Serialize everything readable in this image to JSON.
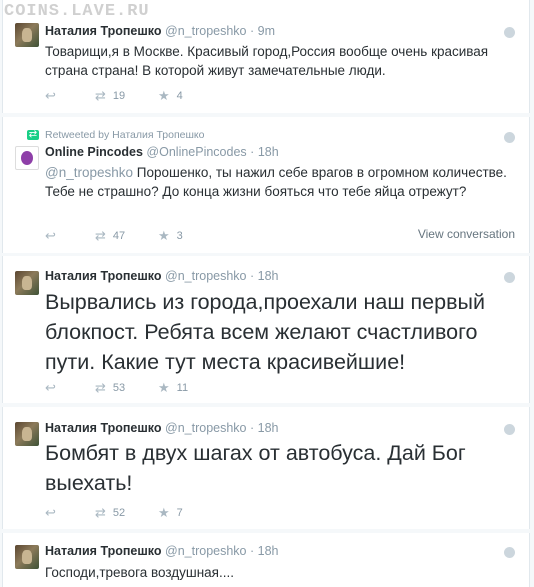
{
  "watermark": "COINS.LAVE.RU",
  "tweets": [
    {
      "name": "Наталия Тропешко",
      "handle": "@n_tropeshko",
      "dot": "·",
      "time": "9m",
      "text": "Товарищи,я в Москве. Красивый город,Россия вообще очень красивая страна страна! В которой живут замечательные люди.",
      "retweets": "19",
      "favorites": "4"
    },
    {
      "retweeted_by": "Retweeted by Наталия Тропешко",
      "name": "Online Pincodes",
      "handle": "@OnlinePincodes",
      "dot": "·",
      "time": "18h",
      "mention": "@n_tropeshko",
      "text": " Порошенко, ты нажил себе врагов в огромном количестве. Тебе не страшно? До конца жизни бояться что тебе яйца отрежут?",
      "retweets": "47",
      "favorites": "3",
      "view_conversation": "View conversation"
    },
    {
      "name": "Наталия Тропешко",
      "handle": "@n_tropeshko",
      "dot": "·",
      "time": "18h",
      "text": "Вырвались из города,проехали наш первый блокпост. Ребята всем желают счастливого пути. Какие тут места красивейшие!",
      "retweets": "53",
      "favorites": "11"
    },
    {
      "name": "Наталия Тропешко",
      "handle": "@n_tropeshko",
      "dot": "·",
      "time": "18h",
      "text": "Бомбят в двух шагах от автобуса. Дай Бог выехать!",
      "retweets": "52",
      "favorites": "7"
    },
    {
      "name": "Наталия Тропешко",
      "handle": "@n_tropeshko",
      "dot": "·",
      "time": "18h",
      "text": "Господи,тревога воздушная...."
    }
  ],
  "icons": {
    "reply": "reply-icon",
    "retweet": "retweet-icon",
    "favorite": "star-icon",
    "globe": "globe-icon"
  },
  "colors": {
    "retweet_green": "#19cf86",
    "muted": "#8899a6",
    "text": "#292f33"
  }
}
